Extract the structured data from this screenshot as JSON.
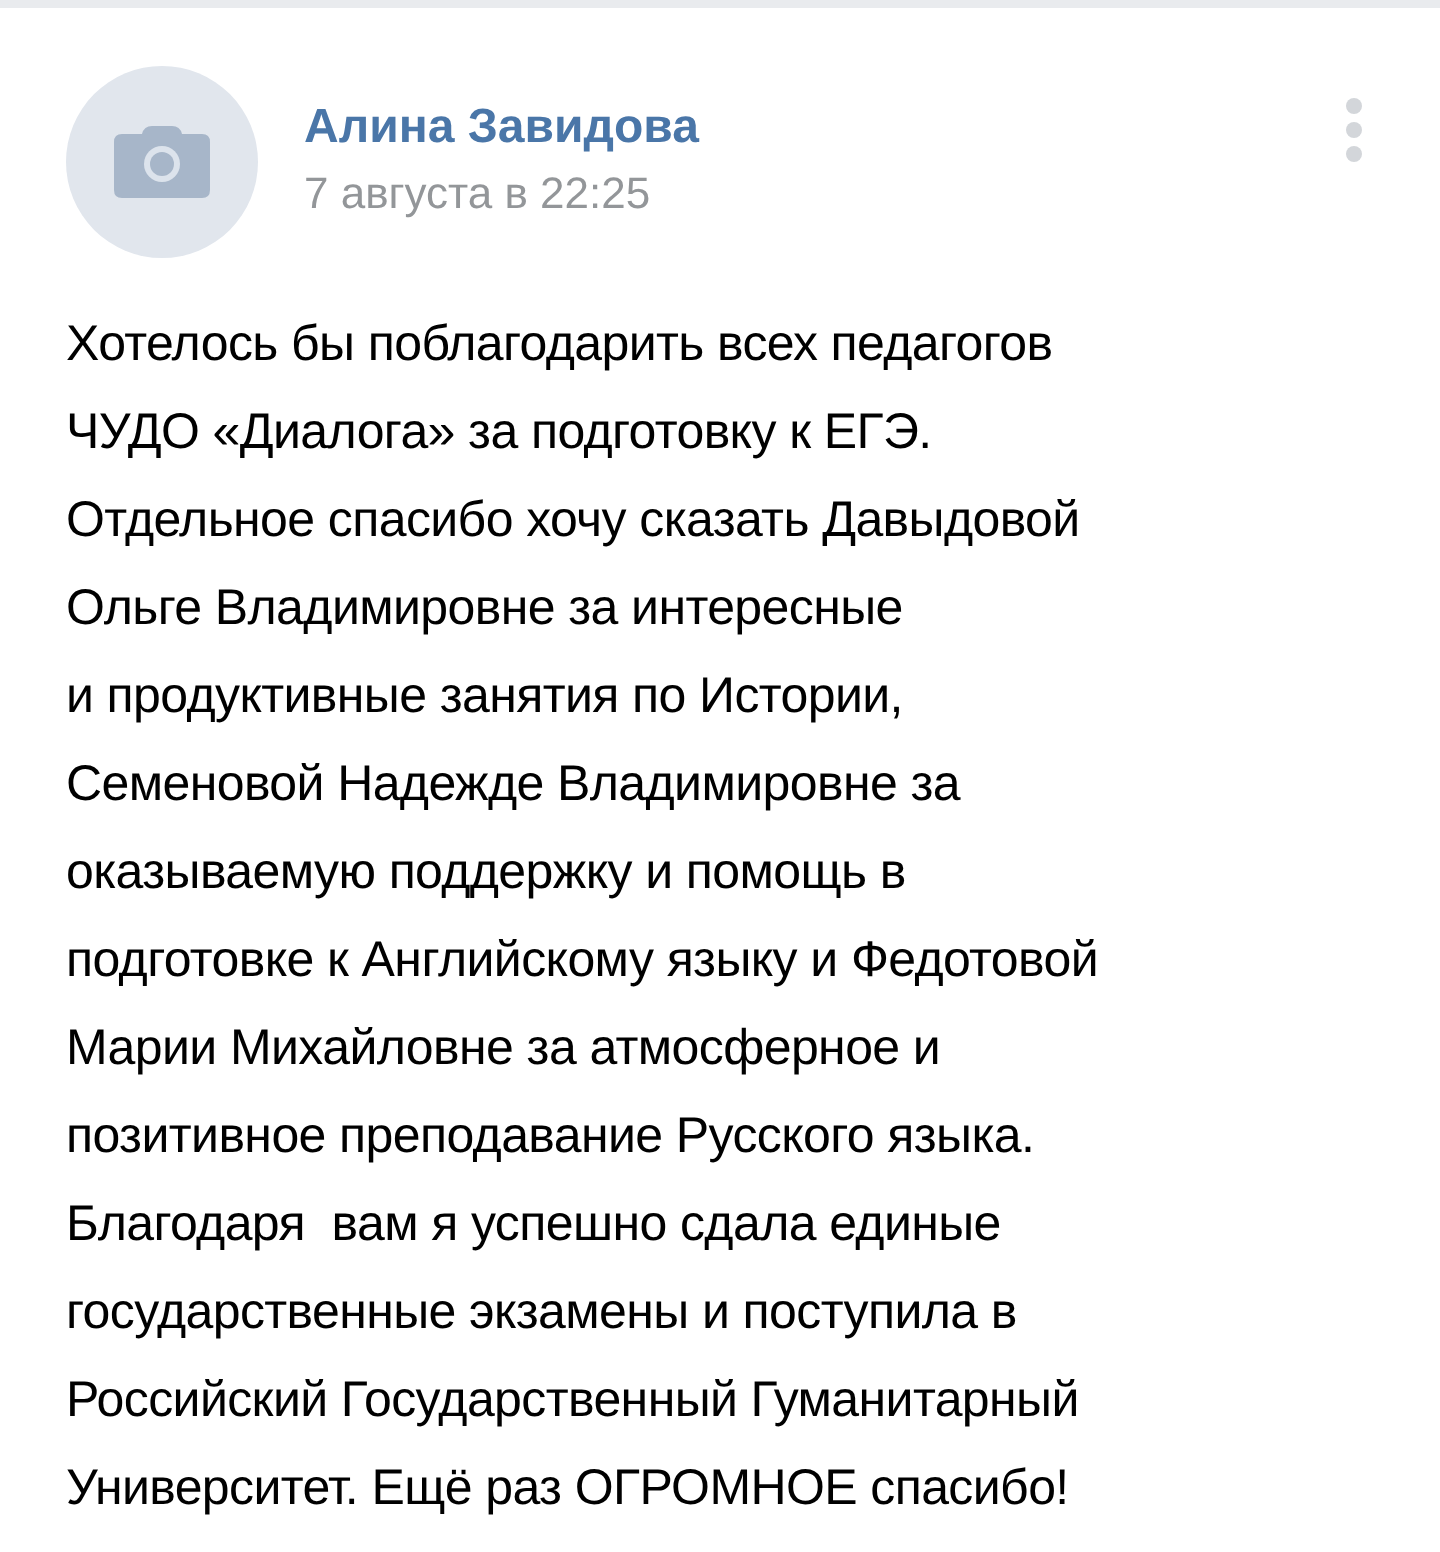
{
  "post": {
    "author": "Алина Завидова",
    "date": "7 августа в 22:25",
    "text_lines": [
      "Хотелось бы поблагодарить всех педагогов",
      "ЧУДО «Диалога» за подготовку к ЕГЭ.",
      "Отдельное спасибо хочу сказать Давыдовой",
      "Ольге Владимировне за интересные",
      "и продуктивные занятия по Истории,",
      "Семеновой Надежде Владимировне за",
      "оказываемую поддержку и помощь в",
      "подготовке к Английскому языку и Федотовой",
      "Марии Михайловне за атмосферное и",
      "позитивное преподавание Русского языка.",
      "Благодаря  вам я успешно сдала единые",
      "государственные экзамены и поступила в",
      "Российский Государственный Гуманитарный",
      "Университет. Ещё раз ОГРОМНОЕ спасибо!"
    ]
  }
}
